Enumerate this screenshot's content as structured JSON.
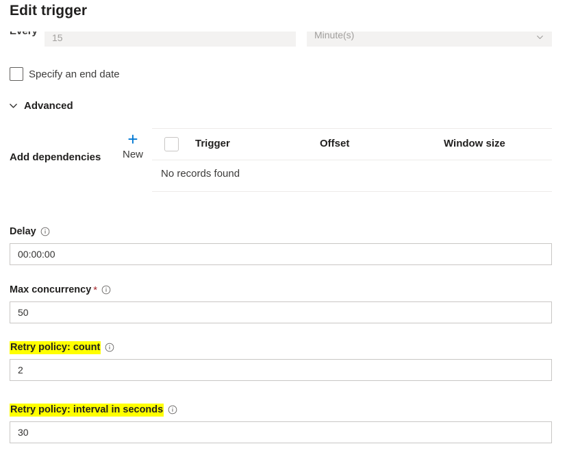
{
  "page": {
    "title": "Edit trigger"
  },
  "recurrence": {
    "every_label": "Every",
    "every_value": "15",
    "unit_value": "Minute(s)",
    "unit_chevron_icon": "chevron-down-icon"
  },
  "end_date": {
    "checkbox_label": "Specify an end date",
    "checked": false
  },
  "advanced": {
    "label": "Advanced",
    "chevron_icon": "chevron-down-icon",
    "expanded": true
  },
  "dependencies": {
    "label": "Add dependencies",
    "new_button": {
      "plus_icon": "plus-icon",
      "label": "New"
    },
    "table": {
      "select_all_checked": false,
      "columns": [
        "Trigger",
        "Offset",
        "Window size"
      ],
      "rows": [],
      "empty_message": "No records found"
    }
  },
  "fields": [
    {
      "key": "delay",
      "label": "Delay",
      "value": "00:00:00",
      "required": false,
      "highlighted": false,
      "info_icon": "info-icon"
    },
    {
      "key": "max_concurrency",
      "label": "Max concurrency",
      "value": "50",
      "required": true,
      "required_marker": "*",
      "highlighted": false,
      "info_icon": "info-icon"
    },
    {
      "key": "retry_count",
      "label": "Retry policy: count",
      "value": "2",
      "required": false,
      "highlighted": true,
      "info_icon": "info-icon"
    },
    {
      "key": "retry_interval",
      "label": "Retry policy: interval in seconds",
      "value": "30",
      "required": false,
      "highlighted": true,
      "info_icon": "info-icon"
    }
  ],
  "colors": {
    "accent": "#0078d4",
    "highlight": "#ffff00",
    "required": "#a4262c",
    "text": "#201f1e",
    "border": "#c8c6c4",
    "disabled_bg": "#f3f2f1"
  }
}
